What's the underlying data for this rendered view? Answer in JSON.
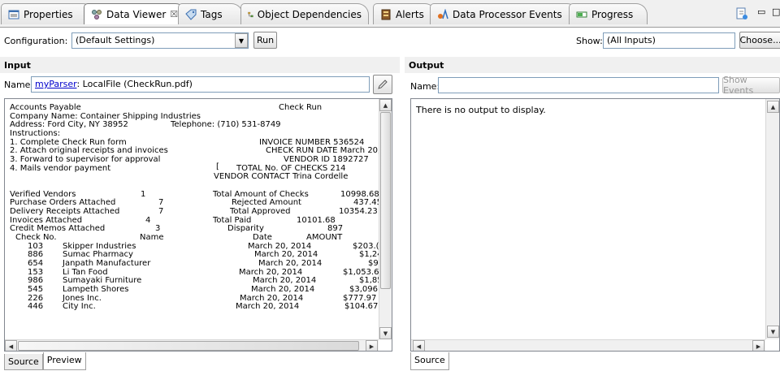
{
  "tabs": [
    {
      "label": "Properties",
      "icon": "properties-icon"
    },
    {
      "label": "Data Viewer",
      "icon": "data-viewer-icon",
      "close": "☒"
    },
    {
      "label": "Tags",
      "icon": "tag-icon"
    },
    {
      "label": "Object Dependencies",
      "icon": "object-dependencies-icon"
    },
    {
      "label": "Alerts",
      "icon": "alerts-icon"
    },
    {
      "label": "Data Processor Events",
      "icon": "data-processor-events-icon"
    },
    {
      "label": "Progress",
      "icon": "progress-icon"
    }
  ],
  "config": {
    "label": "Configuration:",
    "value": "(Default Settings)",
    "run_label": "Run",
    "show_label": "Show:",
    "show_value": "(All Inputs)",
    "choose_label": "Choose..."
  },
  "input": {
    "header": "Input",
    "name_label": "Name:",
    "parser_link": "myParser",
    "source_text": ": LocalFile (CheckRun.pdf)",
    "tabs": [
      "Source",
      "Preview"
    ],
    "lines": [
      [
        "Accounts Payable",
        "Check Run"
      ],
      [
        "Company Name: Container Shipping Industries"
      ],
      [
        "Address: Ford City, NY 38952",
        "Telephone: (710) 531-8749"
      ],
      [
        "Instructions:"
      ],
      [
        "1. Complete Check Run form",
        "INVOICE NUMBER  536524"
      ],
      [
        "2. Attach original receipts and invoices",
        "CHECK RUN DATE  March 20,"
      ],
      [
        "3. Forward to supervisor for approval",
        "VENDOR ID 1892727"
      ],
      [
        "4. Mails vendor payment",
        "[",
        "TOTAL No. OF CHECKS  214"
      ],
      [
        "VENDOR CONTACT  Trina Cordelle"
      ],
      [
        "Verified Vendors",
        "1",
        "Total Amount of Checks",
        "10998.68"
      ],
      [
        "Purchase Orders Attached",
        "7",
        "Rejected Amount",
        "437.45"
      ],
      [
        "Delivery Receipts Attached",
        "7",
        "Total Approved",
        "10354.23"
      ],
      [
        "Invoices Attached",
        "4",
        "Total Paid",
        "10101.68"
      ],
      [
        "Credit Memos Attached",
        "3",
        "Disparity",
        "897"
      ],
      [
        "Check No.",
        "Name",
        "Date",
        "AMOUNT"
      ],
      [
        "103",
        "Skipper Industries",
        "March 20, 2014",
        "$203.("
      ],
      [
        "886",
        "Sumac Pharmacy",
        "March 20, 2014",
        "$1,24"
      ],
      [
        "654",
        "Janpath Manufacturer",
        "March 20, 2014",
        "$9"
      ],
      [
        "153",
        "Li Tan Food",
        "March 20, 2014",
        "$1,053.6"
      ],
      [
        "986",
        "Sumayaki Furniture",
        "March 20, 2014",
        "$1,85"
      ],
      [
        "545",
        "Lampeth Shores",
        "March 20, 2014",
        "$3,096"
      ],
      [
        "226",
        "Jones Inc.",
        "March 20, 2014",
        "$777.97"
      ],
      [
        "446",
        "City Inc.",
        "March 20, 2014",
        "$104.67"
      ]
    ]
  },
  "output": {
    "header": "Output",
    "name_label": "Name:",
    "name_value": "",
    "show_events_label": "Show Events",
    "empty_message": "There is no output to display.",
    "tabs": [
      "Source"
    ]
  }
}
